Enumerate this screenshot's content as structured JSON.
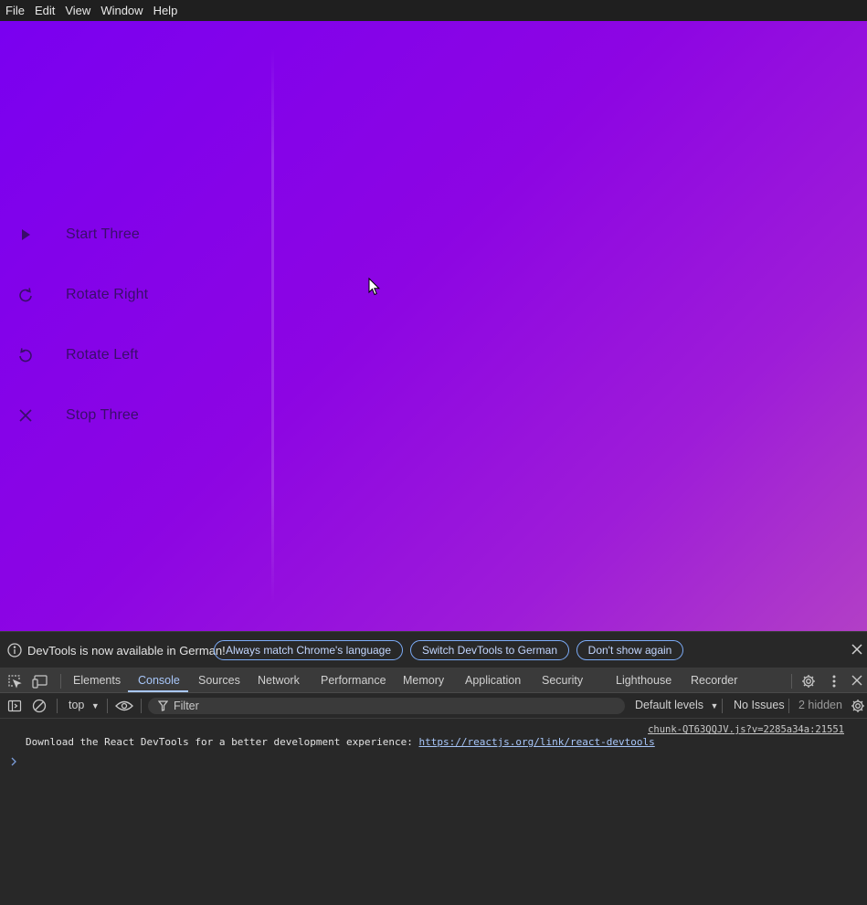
{
  "menubar": {
    "items": [
      {
        "label": "File"
      },
      {
        "label": "Edit"
      },
      {
        "label": "View"
      },
      {
        "label": "Window"
      },
      {
        "label": "Help"
      }
    ]
  },
  "sidebar": {
    "buttons": [
      {
        "label": "Start Three",
        "icon": "play-icon"
      },
      {
        "label": "Rotate Right",
        "icon": "rotate-right-icon"
      },
      {
        "label": "Rotate Left",
        "icon": "rotate-left-icon"
      },
      {
        "label": "Stop Three",
        "icon": "close-icon"
      }
    ]
  },
  "devtools": {
    "infobar": {
      "text": "DevTools is now available in German!",
      "match_language": "Always match Chrome's language",
      "switch_language": "Switch DevTools to German",
      "dont_show": "Don't show again"
    },
    "tabs": [
      {
        "label": "Elements"
      },
      {
        "label": "Console"
      },
      {
        "label": "Sources"
      },
      {
        "label": "Network"
      },
      {
        "label": "Performance"
      },
      {
        "label": "Memory"
      },
      {
        "label": "Application"
      },
      {
        "label": "Security"
      },
      {
        "label": "Lighthouse"
      },
      {
        "label": "Recorder"
      }
    ],
    "active_tab": "Console",
    "toolbar": {
      "context": "top",
      "filter_placeholder": "Filter",
      "levels": "Default levels",
      "issues": "No Issues",
      "hidden": "2 hidden"
    },
    "console": {
      "source_link": "chunk-QT63QQJV.js?v=2285a34a:21551",
      "message": "Download the React DevTools for a better development experience: ",
      "message_link": "https://reactjs.org/link/react-devtools"
    }
  },
  "colors": {
    "accent": "#a8c7fa",
    "gradient_start": "#7a00f0",
    "gradient_end": "#b23fc6",
    "sidebar_text": "#3a0d6b"
  }
}
